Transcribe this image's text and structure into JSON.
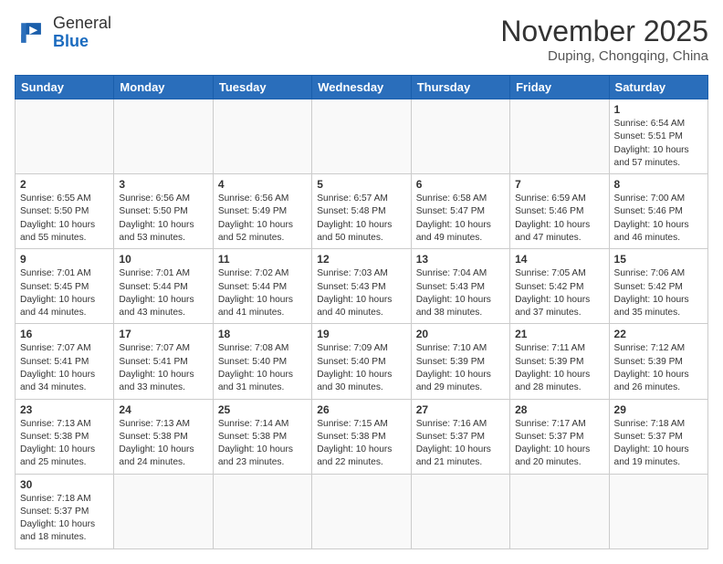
{
  "header": {
    "logo": {
      "general": "General",
      "blue": "Blue"
    },
    "title": "November 2025",
    "subtitle": "Duping, Chongqing, China"
  },
  "weekdays": [
    "Sunday",
    "Monday",
    "Tuesday",
    "Wednesday",
    "Thursday",
    "Friday",
    "Saturday"
  ],
  "weeks": [
    [
      {
        "day": "",
        "empty": true
      },
      {
        "day": "",
        "empty": true
      },
      {
        "day": "",
        "empty": true
      },
      {
        "day": "",
        "empty": true
      },
      {
        "day": "",
        "empty": true
      },
      {
        "day": "",
        "empty": true
      },
      {
        "day": "1",
        "sunrise": "6:54 AM",
        "sunset": "5:51 PM",
        "daylight": "10 hours and 57 minutes."
      }
    ],
    [
      {
        "day": "2",
        "sunrise": "6:55 AM",
        "sunset": "5:50 PM",
        "daylight": "10 hours and 55 minutes."
      },
      {
        "day": "3",
        "sunrise": "6:56 AM",
        "sunset": "5:50 PM",
        "daylight": "10 hours and 53 minutes."
      },
      {
        "day": "4",
        "sunrise": "6:56 AM",
        "sunset": "5:49 PM",
        "daylight": "10 hours and 52 minutes."
      },
      {
        "day": "5",
        "sunrise": "6:57 AM",
        "sunset": "5:48 PM",
        "daylight": "10 hours and 50 minutes."
      },
      {
        "day": "6",
        "sunrise": "6:58 AM",
        "sunset": "5:47 PM",
        "daylight": "10 hours and 49 minutes."
      },
      {
        "day": "7",
        "sunrise": "6:59 AM",
        "sunset": "5:46 PM",
        "daylight": "10 hours and 47 minutes."
      },
      {
        "day": "8",
        "sunrise": "7:00 AM",
        "sunset": "5:46 PM",
        "daylight": "10 hours and 46 minutes."
      }
    ],
    [
      {
        "day": "9",
        "sunrise": "7:01 AM",
        "sunset": "5:45 PM",
        "daylight": "10 hours and 44 minutes."
      },
      {
        "day": "10",
        "sunrise": "7:01 AM",
        "sunset": "5:44 PM",
        "daylight": "10 hours and 43 minutes."
      },
      {
        "day": "11",
        "sunrise": "7:02 AM",
        "sunset": "5:44 PM",
        "daylight": "10 hours and 41 minutes."
      },
      {
        "day": "12",
        "sunrise": "7:03 AM",
        "sunset": "5:43 PM",
        "daylight": "10 hours and 40 minutes."
      },
      {
        "day": "13",
        "sunrise": "7:04 AM",
        "sunset": "5:43 PM",
        "daylight": "10 hours and 38 minutes."
      },
      {
        "day": "14",
        "sunrise": "7:05 AM",
        "sunset": "5:42 PM",
        "daylight": "10 hours and 37 minutes."
      },
      {
        "day": "15",
        "sunrise": "7:06 AM",
        "sunset": "5:42 PM",
        "daylight": "10 hours and 35 minutes."
      }
    ],
    [
      {
        "day": "16",
        "sunrise": "7:07 AM",
        "sunset": "5:41 PM",
        "daylight": "10 hours and 34 minutes."
      },
      {
        "day": "17",
        "sunrise": "7:07 AM",
        "sunset": "5:41 PM",
        "daylight": "10 hours and 33 minutes."
      },
      {
        "day": "18",
        "sunrise": "7:08 AM",
        "sunset": "5:40 PM",
        "daylight": "10 hours and 31 minutes."
      },
      {
        "day": "19",
        "sunrise": "7:09 AM",
        "sunset": "5:40 PM",
        "daylight": "10 hours and 30 minutes."
      },
      {
        "day": "20",
        "sunrise": "7:10 AM",
        "sunset": "5:39 PM",
        "daylight": "10 hours and 29 minutes."
      },
      {
        "day": "21",
        "sunrise": "7:11 AM",
        "sunset": "5:39 PM",
        "daylight": "10 hours and 28 minutes."
      },
      {
        "day": "22",
        "sunrise": "7:12 AM",
        "sunset": "5:39 PM",
        "daylight": "10 hours and 26 minutes."
      }
    ],
    [
      {
        "day": "23",
        "sunrise": "7:13 AM",
        "sunset": "5:38 PM",
        "daylight": "10 hours and 25 minutes."
      },
      {
        "day": "24",
        "sunrise": "7:13 AM",
        "sunset": "5:38 PM",
        "daylight": "10 hours and 24 minutes."
      },
      {
        "day": "25",
        "sunrise": "7:14 AM",
        "sunset": "5:38 PM",
        "daylight": "10 hours and 23 minutes."
      },
      {
        "day": "26",
        "sunrise": "7:15 AM",
        "sunset": "5:38 PM",
        "daylight": "10 hours and 22 minutes."
      },
      {
        "day": "27",
        "sunrise": "7:16 AM",
        "sunset": "5:37 PM",
        "daylight": "10 hours and 21 minutes."
      },
      {
        "day": "28",
        "sunrise": "7:17 AM",
        "sunset": "5:37 PM",
        "daylight": "10 hours and 20 minutes."
      },
      {
        "day": "29",
        "sunrise": "7:18 AM",
        "sunset": "5:37 PM",
        "daylight": "10 hours and 19 minutes."
      }
    ],
    [
      {
        "day": "30",
        "sunrise": "7:18 AM",
        "sunset": "5:37 PM",
        "daylight": "10 hours and 18 minutes."
      },
      {
        "day": "",
        "empty": true
      },
      {
        "day": "",
        "empty": true
      },
      {
        "day": "",
        "empty": true
      },
      {
        "day": "",
        "empty": true
      },
      {
        "day": "",
        "empty": true
      },
      {
        "day": "",
        "empty": true
      }
    ]
  ],
  "labels": {
    "sunrise": "Sunrise:",
    "sunset": "Sunset:",
    "daylight": "Daylight:"
  }
}
